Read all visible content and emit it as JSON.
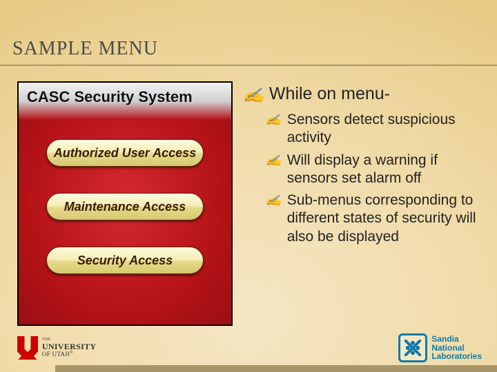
{
  "title": "SAMPLE MENU",
  "menu": {
    "header": "CASC Security System",
    "buttons": [
      "Authorized User Access",
      "Maintenance Access",
      "Security Access"
    ]
  },
  "content": {
    "main": "While on menu-",
    "subs": [
      "Sensors detect suspicious activity",
      "Will display a warning if sensors set alarm off",
      "Sub-menus corresponding to different states of security will also be displayed"
    ]
  },
  "logos": {
    "utah_the": "THE",
    "utah_univ": "UNIVERSITY",
    "utah_of": "OF UTAH",
    "utah_r": "®",
    "sandia_l1": "Sandia",
    "sandia_l2": "National",
    "sandia_l3": "Laboratories"
  }
}
